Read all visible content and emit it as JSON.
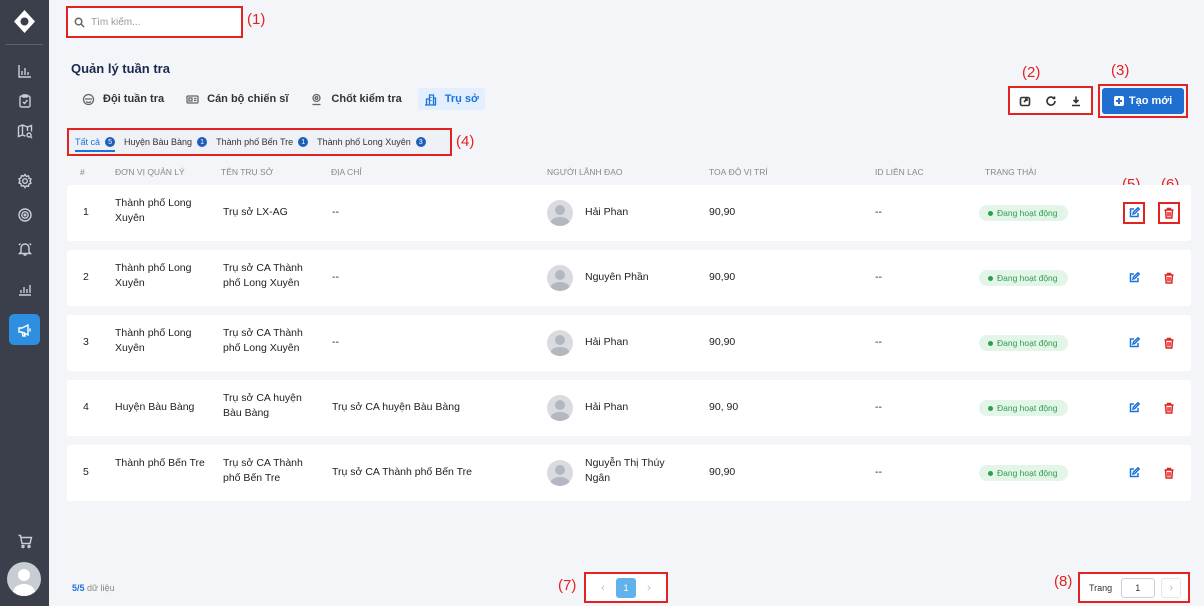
{
  "search": {
    "placeholder": "Tìm kiếm..."
  },
  "page": {
    "title": "Quản lý tuần tra"
  },
  "tabs": [
    {
      "label": "Đội tuần tra",
      "icon": "patrol-team-icon"
    },
    {
      "label": "Cán bộ chiến sĩ",
      "icon": "id-card-icon"
    },
    {
      "label": "Chốt kiểm tra",
      "icon": "checkpoint-icon"
    },
    {
      "label": "Trụ sở",
      "icon": "building-icon",
      "active": true
    }
  ],
  "toolbar": {
    "create_label": "Tạo mới"
  },
  "filters": [
    {
      "label": "Tất cả",
      "count": "5",
      "active": true
    },
    {
      "label": "Huyện Bàu Bàng",
      "count": "1"
    },
    {
      "label": "Thành phố Bến Tre",
      "count": "1"
    },
    {
      "label": "Thành phố Long Xuyên",
      "count": "3"
    }
  ],
  "table": {
    "headers": [
      "#",
      "ĐƠN VỊ QUẢN LÝ",
      "TÊN TRỤ SỞ",
      "ĐỊA CHỈ",
      "NGƯỜI LÃNH ĐẠO",
      "TOẠ ĐỘ VỊ TRÍ",
      "ID LIÊN LẠC",
      "TRẠNG THÁI"
    ],
    "rows": [
      {
        "no": "1",
        "unit": "Thành phố Long Xuyên",
        "name": "Trụ sở LX-AG",
        "address": "--",
        "leader": "Hải Phan",
        "coords": "90,90",
        "contact": "--",
        "status": "Đang hoạt động"
      },
      {
        "no": "2",
        "unit": "Thành phố Long Xuyên",
        "name": "Trụ sở CA Thành phố Long Xuyên",
        "address": "--",
        "leader": "Nguyên Phần",
        "coords": "90,90",
        "contact": "--",
        "status": "Đang hoạt động"
      },
      {
        "no": "3",
        "unit": "Thành phố Long Xuyên",
        "name": "Trụ sở CA Thành phố Long Xuyên",
        "address": "--",
        "leader": "Hải Phan",
        "coords": "90,90",
        "contact": "--",
        "status": "Đang hoạt động"
      },
      {
        "no": "4",
        "unit": "Huyện Bàu Bàng",
        "name": "Trụ sở CA huyện Bàu Bàng",
        "address": "Trụ sở CA huyện Bàu Bàng",
        "leader": "Hải Phan",
        "coords": "90, 90",
        "contact": "--",
        "status": "Đang hoạt động"
      },
      {
        "no": "5",
        "unit": "Thành phố Bến Tre",
        "name": "Trụ sở CA Thành phố Bến Tre",
        "address": "Trụ sở CA Thành phố Bến Tre",
        "leader": "Nguyễn Thị Thúy Ngân",
        "coords": "90,90",
        "contact": "--",
        "status": "Đang hoạt động"
      }
    ]
  },
  "footer": {
    "count": "5/5",
    "count_suffix": "dữ liệu",
    "current_page": "1",
    "goto_label": "Trang",
    "goto_value": "1"
  },
  "callouts": [
    "(1)",
    "(2)",
    "(3)",
    "(4)",
    "(5)",
    "(6)",
    "(7)",
    "(8)"
  ],
  "colors": {
    "sidebar": "#3a3f4b",
    "accent": "#1e6fd0",
    "active_status": "#2f9e4a",
    "delete": "#e02424",
    "annotation": "#e32222"
  }
}
